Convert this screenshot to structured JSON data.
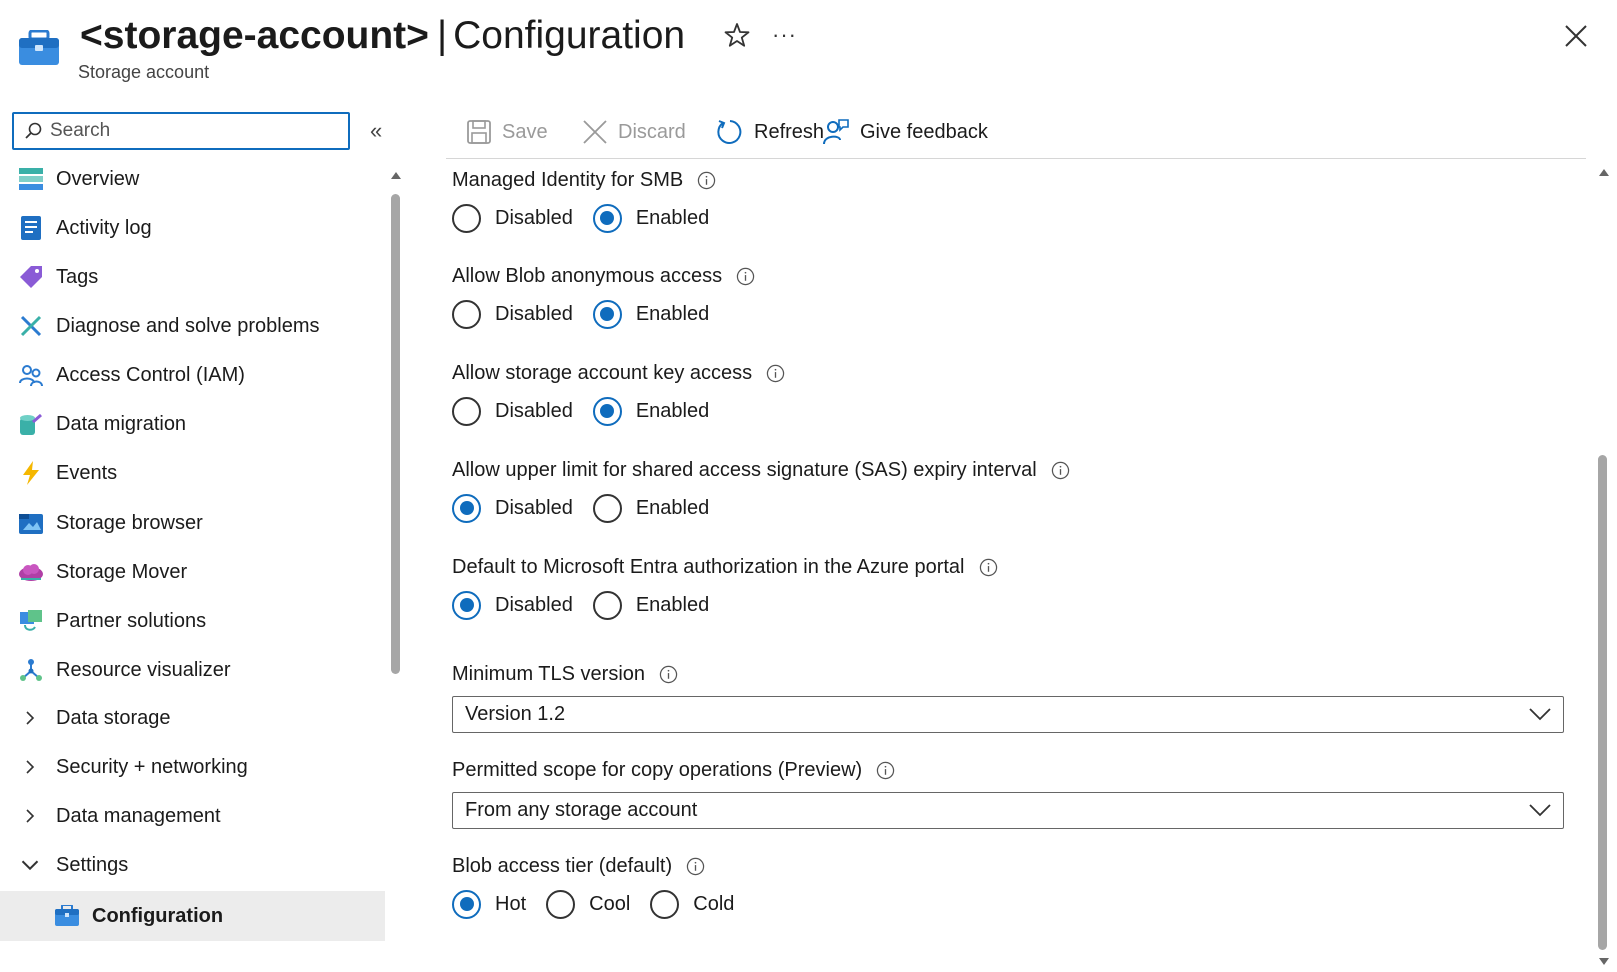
{
  "header": {
    "resource_name": "<storage-account>",
    "separator": "|",
    "page_name": "Configuration",
    "subtitle": "Storage account",
    "more_label": "···"
  },
  "sidebar": {
    "search_placeholder": "Search",
    "collapse_label": "«",
    "items": [
      {
        "label": "Overview",
        "icon": "overview-icon"
      },
      {
        "label": "Activity log",
        "icon": "activity-log-icon"
      },
      {
        "label": "Tags",
        "icon": "tag-icon"
      },
      {
        "label": "Diagnose and solve problems",
        "icon": "wrench-icon"
      },
      {
        "label": "Access Control (IAM)",
        "icon": "people-icon"
      },
      {
        "label": "Data migration",
        "icon": "migration-icon"
      },
      {
        "label": "Events",
        "icon": "lightning-icon"
      },
      {
        "label": "Storage browser",
        "icon": "storage-browser-icon"
      },
      {
        "label": "Storage Mover",
        "icon": "cloud-icon"
      },
      {
        "label": "Partner solutions",
        "icon": "partner-icon"
      },
      {
        "label": "Resource visualizer",
        "icon": "network-icon"
      },
      {
        "label": "Data storage",
        "icon": "chevron-right-icon"
      },
      {
        "label": "Security + networking",
        "icon": "chevron-right-icon"
      },
      {
        "label": "Data management",
        "icon": "chevron-right-icon"
      },
      {
        "label": "Settings",
        "icon": "chevron-down-icon"
      },
      {
        "label": "Configuration",
        "icon": "toolbox-icon"
      }
    ]
  },
  "toolbar": {
    "save": "Save",
    "discard": "Discard",
    "refresh": "Refresh",
    "feedback": "Give feedback"
  },
  "settings": {
    "smb": {
      "label": "Managed Identity for SMB",
      "opt1": "Disabled",
      "opt2": "Enabled",
      "selected": "Enabled"
    },
    "blob_anon": {
      "label": "Allow Blob anonymous access",
      "opt1": "Disabled",
      "opt2": "Enabled",
      "selected": "Enabled"
    },
    "key_access": {
      "label": "Allow storage account key access",
      "opt1": "Disabled",
      "opt2": "Enabled",
      "selected": "Enabled"
    },
    "sas_limit": {
      "label": "Allow upper limit for shared access signature (SAS) expiry interval",
      "opt1": "Disabled",
      "opt2": "Enabled",
      "selected": "Disabled"
    },
    "entra_default": {
      "label": "Default to Microsoft Entra authorization in the Azure portal",
      "opt1": "Disabled",
      "opt2": "Enabled",
      "selected": "Disabled"
    },
    "tls": {
      "label": "Minimum TLS version",
      "value": "Version 1.2"
    },
    "copy_scope": {
      "label": "Permitted scope for copy operations (Preview)",
      "value": "From any storage account"
    },
    "access_tier": {
      "label": "Blob access tier (default)",
      "opt1": "Hot",
      "opt2": "Cool",
      "opt3": "Cold",
      "selected": "Hot"
    }
  },
  "colors": {
    "accent": "#0f6cbd",
    "active_bg": "#ececec"
  }
}
